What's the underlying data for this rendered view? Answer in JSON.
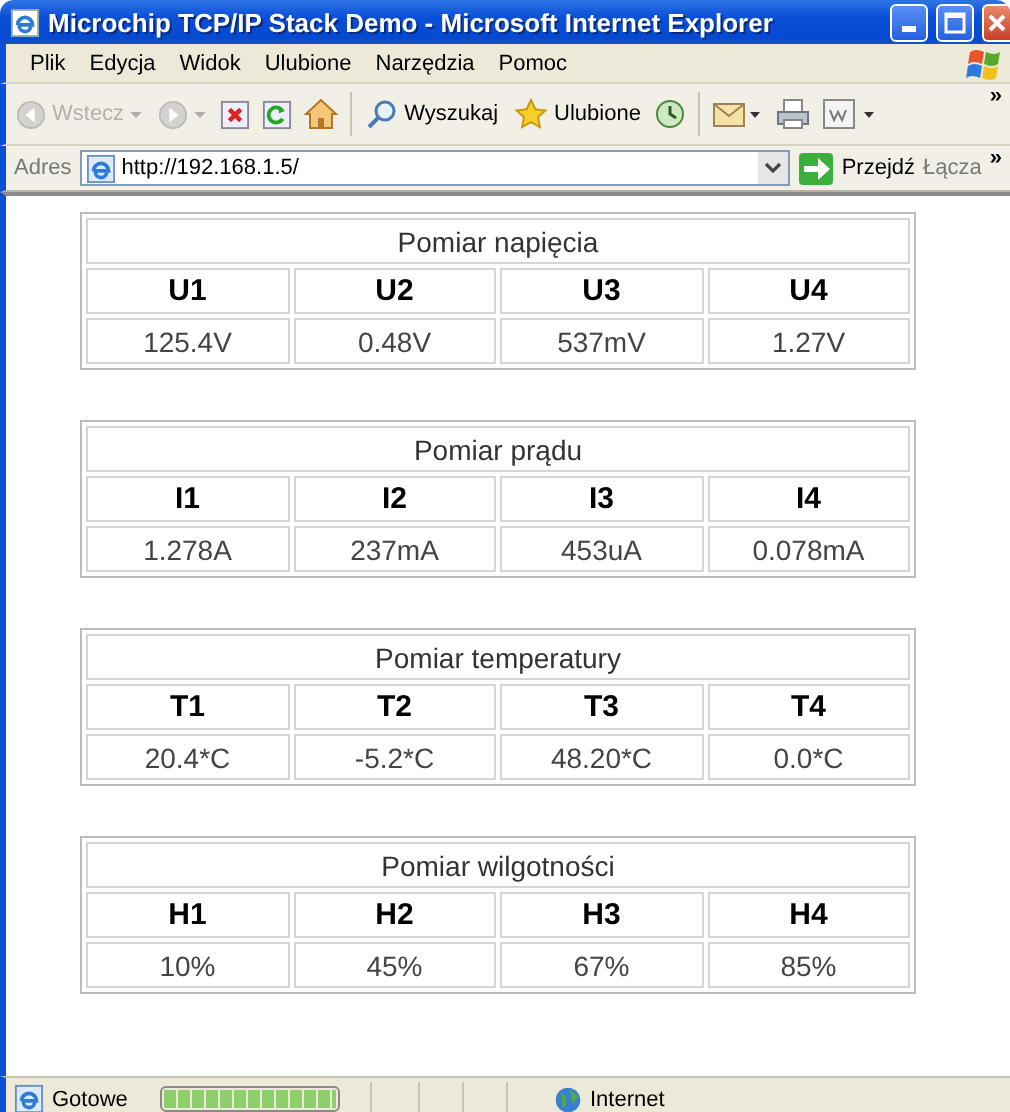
{
  "window": {
    "title": "Microchip TCP/IP Stack Demo - Microsoft Internet Explorer"
  },
  "menu": [
    "Plik",
    "Edycja",
    "Widok",
    "Ulubione",
    "Narzędzia",
    "Pomoc"
  ],
  "toolbar": [
    {
      "kind": "back",
      "label": "Wstecz",
      "disabled": true
    },
    {
      "kind": "forward",
      "disabled": true
    },
    {
      "kind": "stop"
    },
    {
      "kind": "refresh"
    },
    {
      "kind": "home"
    },
    {
      "kind": "search",
      "label": "Wyszukaj"
    },
    {
      "kind": "favorites",
      "label": "Ulubione"
    },
    {
      "kind": "history"
    },
    {
      "kind": "mail"
    },
    {
      "kind": "print"
    },
    {
      "kind": "edit"
    },
    {
      "kind": "more",
      "label": "»"
    }
  ],
  "address": {
    "label": "Adres",
    "value": "http://192.168.1.5/",
    "go": "Przejdź",
    "links": "Łącza",
    "more": "»"
  },
  "tables": [
    {
      "title": "Pomiar napięcia",
      "columns": [
        "U1",
        "U2",
        "U3",
        "U4"
      ],
      "values": [
        "125.4V",
        "0.48V",
        "537mV",
        "1.27V"
      ]
    },
    {
      "title": "Pomiar prądu",
      "columns": [
        "I1",
        "I2",
        "I3",
        "I4"
      ],
      "values": [
        "1.278A",
        "237mA",
        "453uA",
        "0.078mA"
      ]
    },
    {
      "title": "Pomiar temperatury",
      "columns": [
        "T1",
        "T2",
        "T3",
        "T4"
      ],
      "values": [
        "20.4*C",
        "-5.2*C",
        "48.20*C",
        "0.0*C"
      ]
    },
    {
      "title": "Pomiar wilgotności",
      "columns": [
        "H1",
        "H2",
        "H3",
        "H4"
      ],
      "values": [
        "10%",
        "45%",
        "67%",
        "85%"
      ]
    }
  ],
  "status_bar": {
    "text": "Gotowe",
    "progress": {
      "level": 1
    },
    "zone": "Internet"
  }
}
